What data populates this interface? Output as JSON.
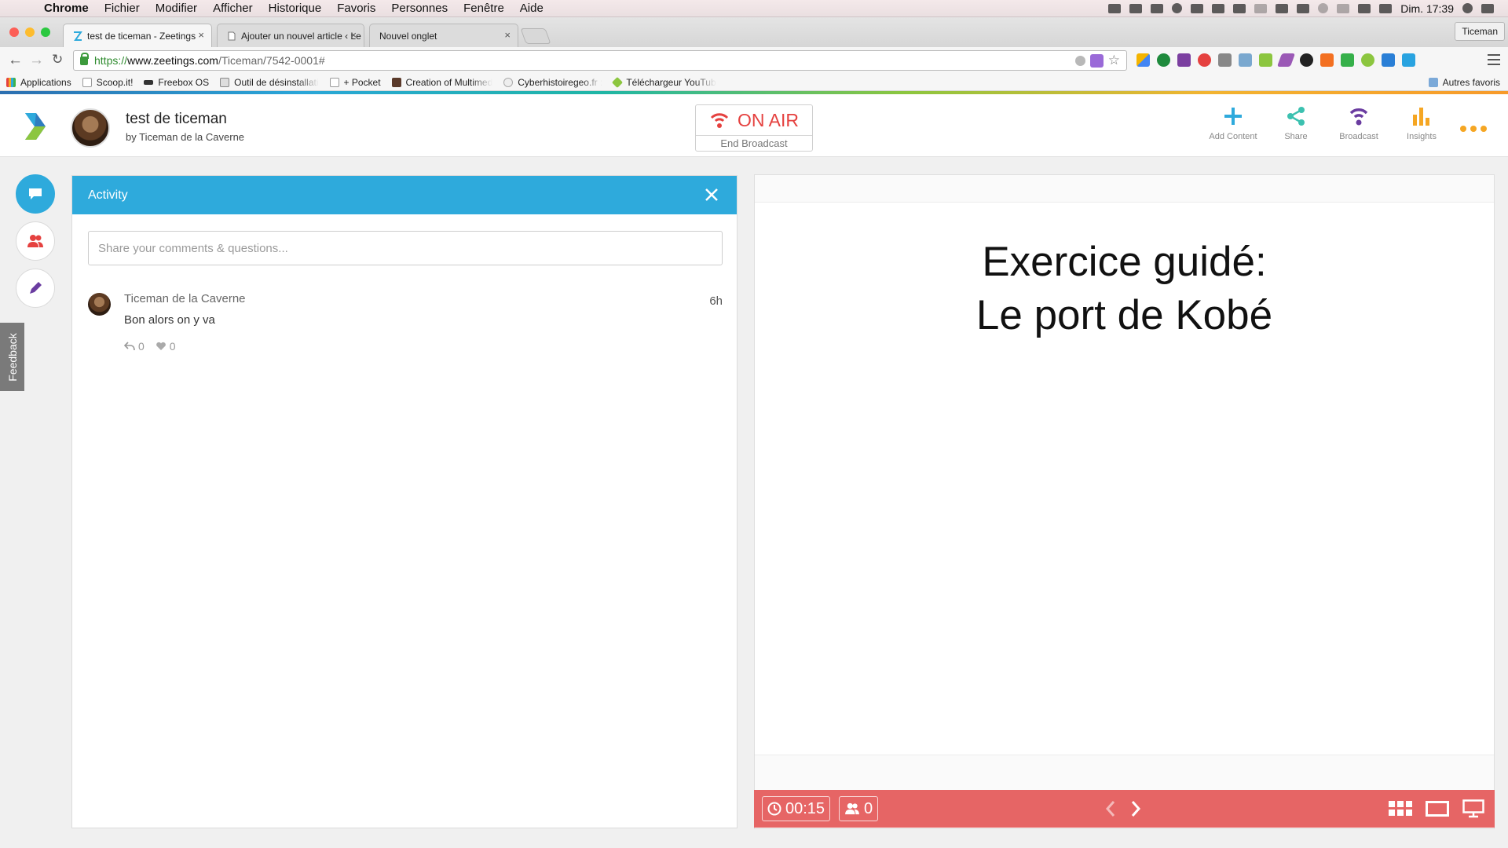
{
  "menubar": {
    "app": "Chrome",
    "items": [
      "Fichier",
      "Modifier",
      "Afficher",
      "Historique",
      "Favoris",
      "Personnes",
      "Fenêtre",
      "Aide"
    ],
    "clock": "Dim. 17:39"
  },
  "tabs": [
    {
      "label": "test de ticeman - Zeetings",
      "close": "×"
    },
    {
      "label": "Ajouter un nouvel article ‹ Le",
      "close": "×"
    },
    {
      "label": "Nouvel onglet",
      "close": "×"
    }
  ],
  "profile": "Ticeman",
  "omnibox": {
    "scheme": "https://",
    "host": "www.zeetings.com",
    "path": "/Ticeman/7542-0001#"
  },
  "bookmarks": {
    "apps": "Applications",
    "items": [
      "Scoop.it!",
      "Freebox OS",
      "Outil de désinstallati",
      "+ Pocket",
      "Creation of Multimed",
      "Cyberhistoiregeo.fr :",
      "Téléchargeur YouTub"
    ],
    "other": "Autres favoris"
  },
  "header": {
    "title": "test de ticeman",
    "byline": "by Ticeman de la Caverne",
    "onair": "ON AIR",
    "end_broadcast": "End Broadcast",
    "actions": {
      "add_content": "Add Content",
      "share": "Share",
      "broadcast": "Broadcast",
      "insights": "Insights"
    }
  },
  "sidebar": {
    "feedback": "Feedback"
  },
  "activity": {
    "title": "Activity",
    "input_placeholder": "Share your comments & questions...",
    "comments": [
      {
        "author": "Ticeman de la Caverne",
        "time": "6h",
        "text": "Bon alors on y va",
        "replies": "0",
        "likes": "0"
      }
    ]
  },
  "slide": {
    "line1": "Exercice guidé:",
    "line2": "Le port de Kobé"
  },
  "broadcast_bar": {
    "timer": "00:15",
    "attendees": "0"
  },
  "colors": {
    "accent_blue": "#2eaadc",
    "onair_red": "#e5413f",
    "broadcast_bar": "#e66565",
    "share_teal": "#3cc1b0",
    "broadcast_purple": "#6a3ca0",
    "insights_orange": "#f5a623"
  }
}
